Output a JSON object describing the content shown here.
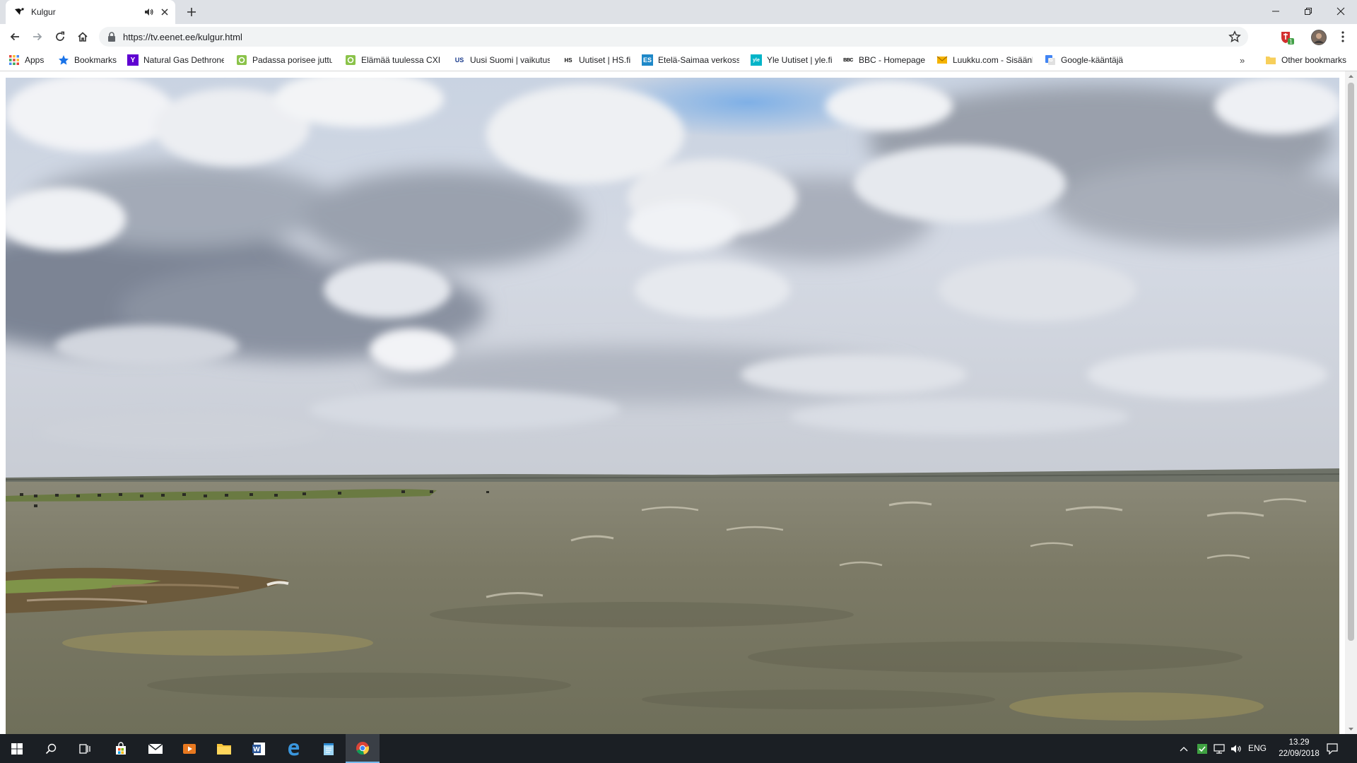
{
  "browser": {
    "tab": {
      "title": "Kulgur"
    },
    "address_bar": {
      "url": "https://tv.eenet.ee/kulgur.html"
    },
    "bookmarks": [
      {
        "label": "Apps",
        "icon": "apps-grid-icon",
        "color": "#e8453c"
      },
      {
        "label": "Bookmarks",
        "icon": "star-icon",
        "color": "#1a73e8"
      },
      {
        "label": "Natural Gas Dethrone",
        "icon": "yahoo-icon",
        "color": "#5f01d1",
        "glyph": "Y"
      },
      {
        "label": "Padassa porisee juttu",
        "icon": "green-site-icon",
        "color": "#8bc34a",
        "glyph": ""
      },
      {
        "label": "Elämää tuulessa CXIII",
        "icon": "green-site-icon",
        "color": "#8bc34a",
        "glyph": ""
      },
      {
        "label": "Uusi Suomi | vaikutus",
        "icon": "us-icon",
        "color": "#ffffff",
        "glyph": "US"
      },
      {
        "label": "Uutiset | HS.fi",
        "icon": "hs-icon",
        "color": "#ffffff",
        "glyph": "HS"
      },
      {
        "label": "Etelä-Saimaa verkoss",
        "icon": "es-icon",
        "color": "#1e88c8",
        "glyph": "ES"
      },
      {
        "label": "Yle Uutiset | yle.fi",
        "icon": "yle-icon",
        "color": "#00b4c8",
        "glyph": "yle"
      },
      {
        "label": "BBC - Homepage",
        "icon": "bbc-icon",
        "color": "#ffffff",
        "glyph": "BBC"
      },
      {
        "label": "Luukku.com - Sisäänk",
        "icon": "mail-envelope-icon",
        "color": "#f5b400",
        "glyph": ""
      },
      {
        "label": "Google-kääntäjä",
        "icon": "google-translate-icon",
        "color": "#4285f4",
        "glyph": "G"
      }
    ],
    "overflow_label": "»",
    "other_bookmarks": "Other bookmarks"
  },
  "taskbar": {
    "apps": [
      "start-icon",
      "search-icon",
      "task-view-icon",
      "store-icon",
      "mail-icon",
      "media-icon",
      "file-explorer-icon",
      "word-icon",
      "edge-icon",
      "notepad-icon",
      "chrome-icon"
    ],
    "tray": {
      "language": "ENG",
      "time": "13.29",
      "date": "22/09/2018"
    }
  },
  "colors": {
    "tab_strip": "#dee1e6",
    "taskbar": "#1b1f24",
    "sky_blue": "#7fb0e6",
    "water": "#7a7a68"
  }
}
